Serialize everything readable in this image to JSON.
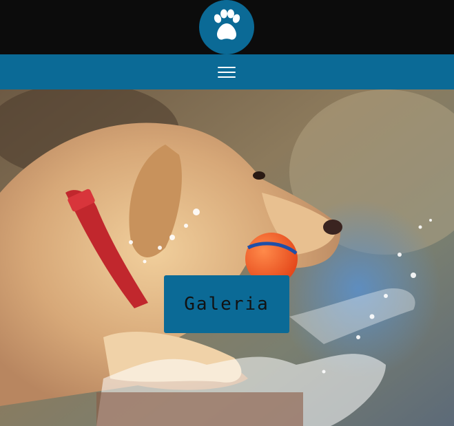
{
  "header": {
    "logo_icon": "paw-icon",
    "background_color": "#0c0c0c",
    "brand_color": "#0b6a96"
  },
  "nav": {
    "menu_icon": "hamburger-menu-icon"
  },
  "hero": {
    "image": "golden-retriever-with-ball-in-water",
    "button_label": "Galeria"
  }
}
